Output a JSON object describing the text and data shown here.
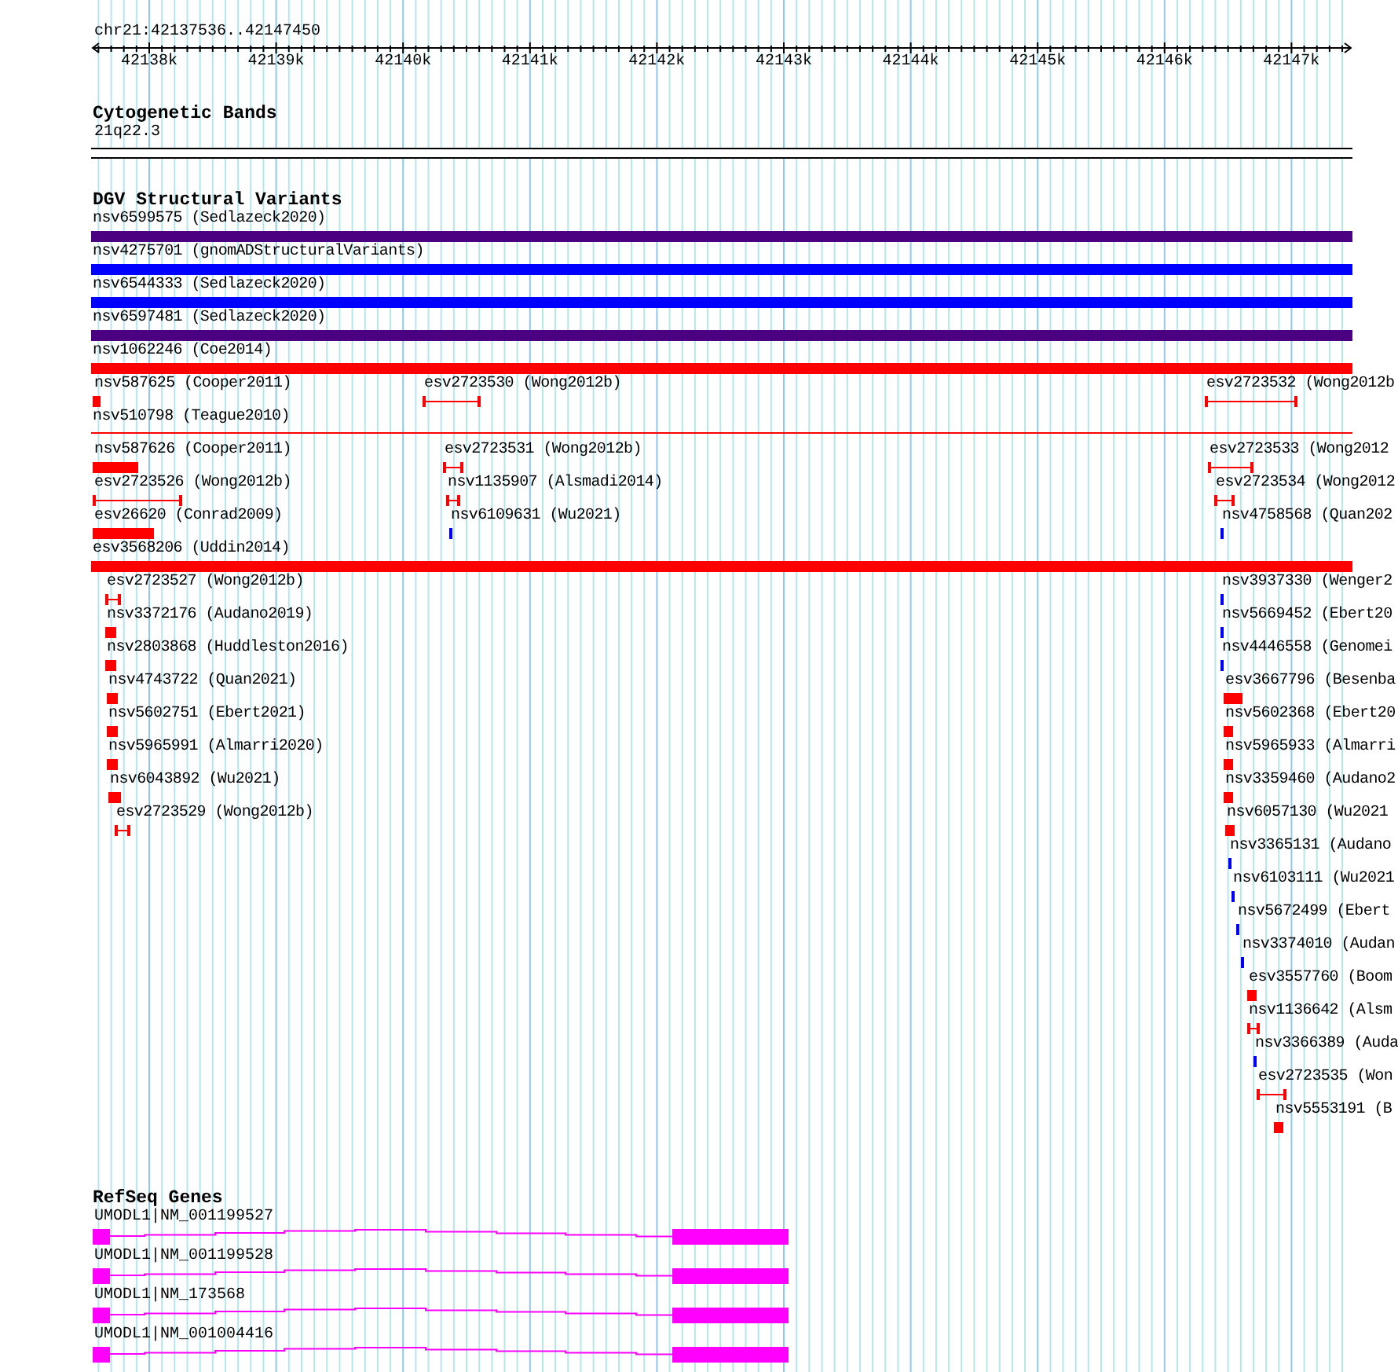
{
  "ruler": {
    "location": "chr21:42137536..42147450",
    "ticks": [
      "42138k",
      "42139k",
      "42140k",
      "42141k",
      "42142k",
      "42143k",
      "42144k",
      "42145k",
      "42146k",
      "42147k"
    ]
  },
  "tracks": [
    {
      "kind": "cytoband",
      "title": "Cytogenetic Bands",
      "bands": [
        {
          "label": "21q22.3"
        }
      ]
    },
    {
      "kind": "variants",
      "title": "DGV Structural Variants",
      "rows": [
        {
          "features": [
            {
              "label": "nsv6599575 (Sedlazeck2020)",
              "kind": "bar",
              "color": "#4b0082"
            }
          ]
        },
        {
          "features": [
            {
              "label": "nsv4275701 (gnomADStructuralVariants)",
              "kind": "bar",
              "color": "#0000ff"
            }
          ]
        },
        {
          "features": [
            {
              "label": "nsv6544333 (Sedlazeck2020)",
              "kind": "bar",
              "color": "#0000ff"
            }
          ]
        },
        {
          "features": [
            {
              "label": "nsv6597481 (Sedlazeck2020)",
              "kind": "bar",
              "color": "#4b0082"
            }
          ]
        },
        {
          "features": [
            {
              "label": "nsv1062246 (Coe2014)",
              "kind": "bar",
              "color": "#ff0000"
            }
          ]
        },
        {
          "features": [
            {
              "label": "nsv587625 (Cooper2011)",
              "kind": "bar",
              "color": "#ff0000"
            },
            {
              "label": "esv2723530 (Wong2012b)",
              "kind": "interval",
              "color": "#ff0000"
            },
            {
              "label": "esv2723532 (Wong2012b",
              "kind": "interval",
              "color": "#ff0000"
            }
          ]
        },
        {
          "features": [
            {
              "label": "nsv510798 (Teague2010)",
              "kind": "line",
              "color": "#ff0000"
            }
          ]
        },
        {
          "features": [
            {
              "label": "nsv587626 (Cooper2011)",
              "kind": "bar",
              "color": "#ff0000"
            },
            {
              "label": "esv2723531 (Wong2012b)",
              "kind": "interval",
              "color": "#ff0000"
            },
            {
              "label": "esv2723533 (Wong2012",
              "kind": "interval",
              "color": "#ff0000"
            }
          ]
        },
        {
          "features": [
            {
              "label": "esv2723526 (Wong2012b)",
              "kind": "interval",
              "color": "#ff0000"
            },
            {
              "label": "nsv1135907 (Alsmadi2014)",
              "kind": "interval",
              "color": "#ff0000"
            },
            {
              "label": "esv2723534 (Wong2012",
              "kind": "interval",
              "color": "#ff0000"
            }
          ]
        },
        {
          "features": [
            {
              "label": "esv26620 (Conrad2009)",
              "kind": "bar",
              "color": "#ff0000"
            },
            {
              "label": "nsv6109631 (Wu2021)",
              "kind": "bar",
              "color": "#0000ff"
            },
            {
              "label": "nsv4758568 (Quan202",
              "kind": "bar",
              "color": "#0000ff"
            }
          ]
        },
        {
          "features": [
            {
              "label": "esv3568206 (Uddin2014)",
              "kind": "bar",
              "color": "#ff0000"
            }
          ]
        },
        {
          "features": [
            {
              "label": "esv2723527 (Wong2012b)",
              "kind": "interval",
              "color": "#ff0000"
            },
            {
              "label": "nsv3937330 (Wenger2",
              "kind": "bar",
              "color": "#0000ff"
            }
          ]
        },
        {
          "features": [
            {
              "label": "nsv3372176 (Audano2019)",
              "kind": "bar",
              "color": "#ff0000"
            },
            {
              "label": "nsv5669452 (Ebert20",
              "kind": "bar",
              "color": "#0000ff"
            }
          ]
        },
        {
          "features": [
            {
              "label": "nsv2803868 (Huddleston2016)",
              "kind": "bar",
              "color": "#ff0000"
            },
            {
              "label": "nsv4446558 (Genomei",
              "kind": "bar",
              "color": "#0000ff"
            }
          ]
        },
        {
          "features": [
            {
              "label": "nsv4743722 (Quan2021)",
              "kind": "bar",
              "color": "#ff0000"
            },
            {
              "label": "esv3667796 (Besenba",
              "kind": "bar",
              "color": "#ff0000"
            }
          ]
        },
        {
          "features": [
            {
              "label": "nsv5602751 (Ebert2021)",
              "kind": "bar",
              "color": "#ff0000"
            },
            {
              "label": "nsv5602368 (Ebert20",
              "kind": "bar",
              "color": "#ff0000"
            }
          ]
        },
        {
          "features": [
            {
              "label": "nsv5965991 (Almarri2020)",
              "kind": "bar",
              "color": "#ff0000"
            },
            {
              "label": "nsv5965933 (Almarri",
              "kind": "bar",
              "color": "#ff0000"
            }
          ]
        },
        {
          "features": [
            {
              "label": "nsv6043892 (Wu2021)",
              "kind": "bar",
              "color": "#ff0000"
            },
            {
              "label": "nsv3359460 (Audano2",
              "kind": "bar",
              "color": "#ff0000"
            }
          ]
        },
        {
          "features": [
            {
              "label": "esv2723529 (Wong2012b)",
              "kind": "interval",
              "color": "#ff0000"
            },
            {
              "label": "nsv6057130 (Wu2021",
              "kind": "bar",
              "color": "#ff0000"
            }
          ]
        },
        {
          "features": [
            {
              "label": "nsv3365131 (Audano",
              "kind": "bar",
              "color": "#0000ff"
            }
          ]
        },
        {
          "features": [
            {
              "label": "nsv6103111 (Wu2021",
              "kind": "bar",
              "color": "#0000ff"
            }
          ]
        },
        {
          "features": [
            {
              "label": "nsv5672499 (Ebert",
              "kind": "bar",
              "color": "#0000ff"
            }
          ]
        },
        {
          "features": [
            {
              "label": "nsv3374010 (Audan",
              "kind": "bar",
              "color": "#0000ff"
            }
          ]
        },
        {
          "features": [
            {
              "label": "esv3557760 (Boom",
              "kind": "bar",
              "color": "#ff0000"
            }
          ]
        },
        {
          "features": [
            {
              "label": "nsv1136642 (Alsm",
              "kind": "interval",
              "color": "#ff0000"
            }
          ]
        },
        {
          "features": [
            {
              "label": "nsv3366389 (Auda",
              "kind": "bar",
              "color": "#0000ff"
            }
          ]
        },
        {
          "features": [
            {
              "label": "esv2723535 (Won",
              "kind": "interval",
              "color": "#ff0000"
            }
          ]
        },
        {
          "features": [
            {
              "label": "nsv5553191 (B",
              "kind": "bar",
              "color": "#ff0000"
            }
          ]
        }
      ]
    },
    {
      "kind": "genes",
      "title": "RefSeq Genes",
      "genes": [
        {
          "label": "UMODL1|NM_001199527"
        },
        {
          "label": "UMODL1|NM_001199528"
        },
        {
          "label": "UMODL1|NM_173568"
        },
        {
          "label": "UMODL1|NM_001004416"
        }
      ]
    }
  ]
}
